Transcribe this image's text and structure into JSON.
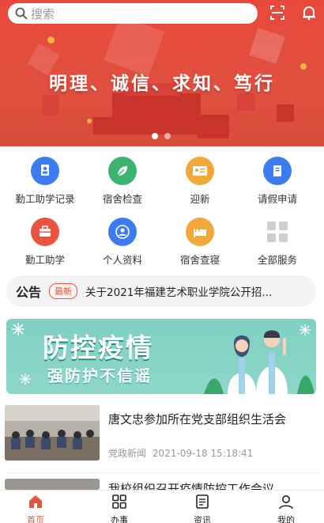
{
  "search": {
    "placeholder": "搜索"
  },
  "hero": {
    "slogan": "明理、诚信、求知、笃行"
  },
  "grid": [
    {
      "label": "勤工助学记录",
      "icon": "student-record-icon",
      "color": "#3d7cf0"
    },
    {
      "label": "宿舍检查",
      "icon": "leaf-icon",
      "color": "#3cb371"
    },
    {
      "label": "迎新",
      "icon": "id-card-icon",
      "color": "#f2a93b"
    },
    {
      "label": "请假申请",
      "icon": "scroll-icon",
      "color": "#3d7cf0"
    },
    {
      "label": "勤工助学",
      "icon": "toolbox-icon",
      "color": "#e9533f"
    },
    {
      "label": "个人资料",
      "icon": "person-icon",
      "color": "#3d7cf0"
    },
    {
      "label": "宿舍查寝",
      "icon": "bed-icon",
      "color": "#f2a93b"
    },
    {
      "label": "全部服务",
      "icon": "apps-grid-icon",
      "color": "#cfcfcf"
    }
  ],
  "notice": {
    "title": "公告",
    "badge": "最新",
    "text": "关于2021年福建艺术职业学院公开招..."
  },
  "banner": {
    "main": "防控疫情",
    "sub": "强防护不信谣"
  },
  "news": [
    {
      "title": "唐文忠参加所在党支部组织生活会",
      "category": "党政新闻",
      "datetime": "2021-09-18 15:18:41"
    },
    {
      "title": "我校组织召开疫情防控工作会议"
    }
  ],
  "tabs": [
    {
      "label": "首页",
      "icon": "home-icon"
    },
    {
      "label": "办事",
      "icon": "grid-icon"
    },
    {
      "label": "资讯",
      "icon": "news-icon"
    },
    {
      "label": "我的",
      "icon": "user-icon"
    }
  ],
  "colors": {
    "accent": "#e5533f",
    "hero": "#e9493c",
    "banner": "#8dd7ca"
  }
}
